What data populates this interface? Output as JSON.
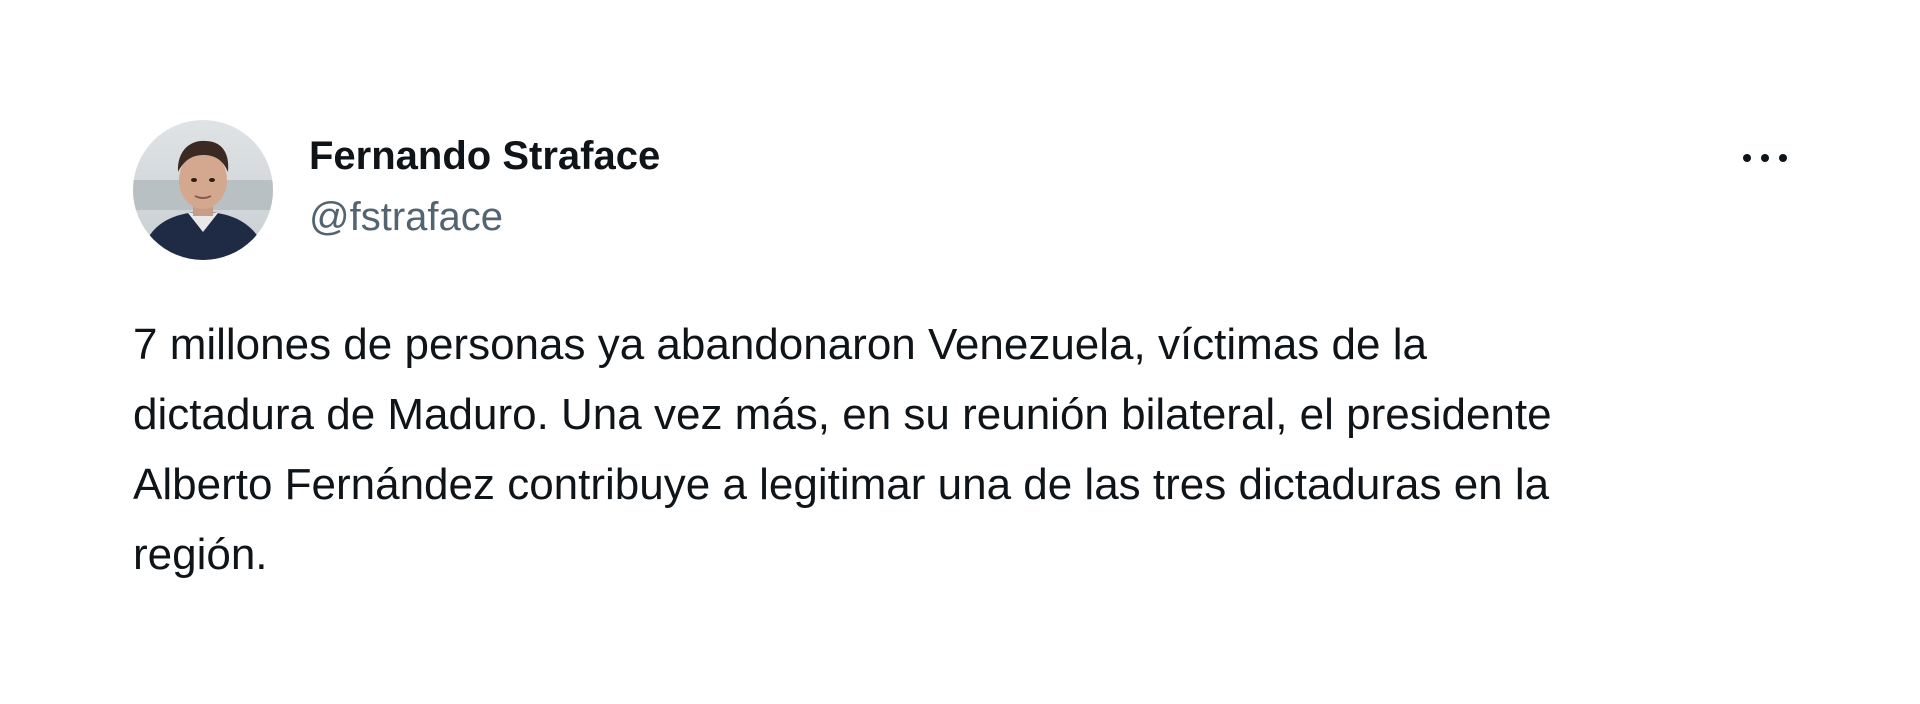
{
  "author": {
    "display_name": "Fernando Straface",
    "handle": "@fstraface",
    "avatar": "profile-photo"
  },
  "menu": {
    "icon": "more-horizontal-icon"
  },
  "tweet": {
    "lines": [
      "7 millones de personas ya abandonaron Venezuela, víctimas de la",
      "dictadura de Maduro. Una vez más, en su reunión bilateral, el presidente",
      "Alberto Fernández contribuye a legitimar una de las tres dictaduras en la",
      "región."
    ]
  },
  "colors": {
    "background": "#ffffff",
    "text_primary": "#0f1419",
    "text_secondary": "#536471"
  }
}
